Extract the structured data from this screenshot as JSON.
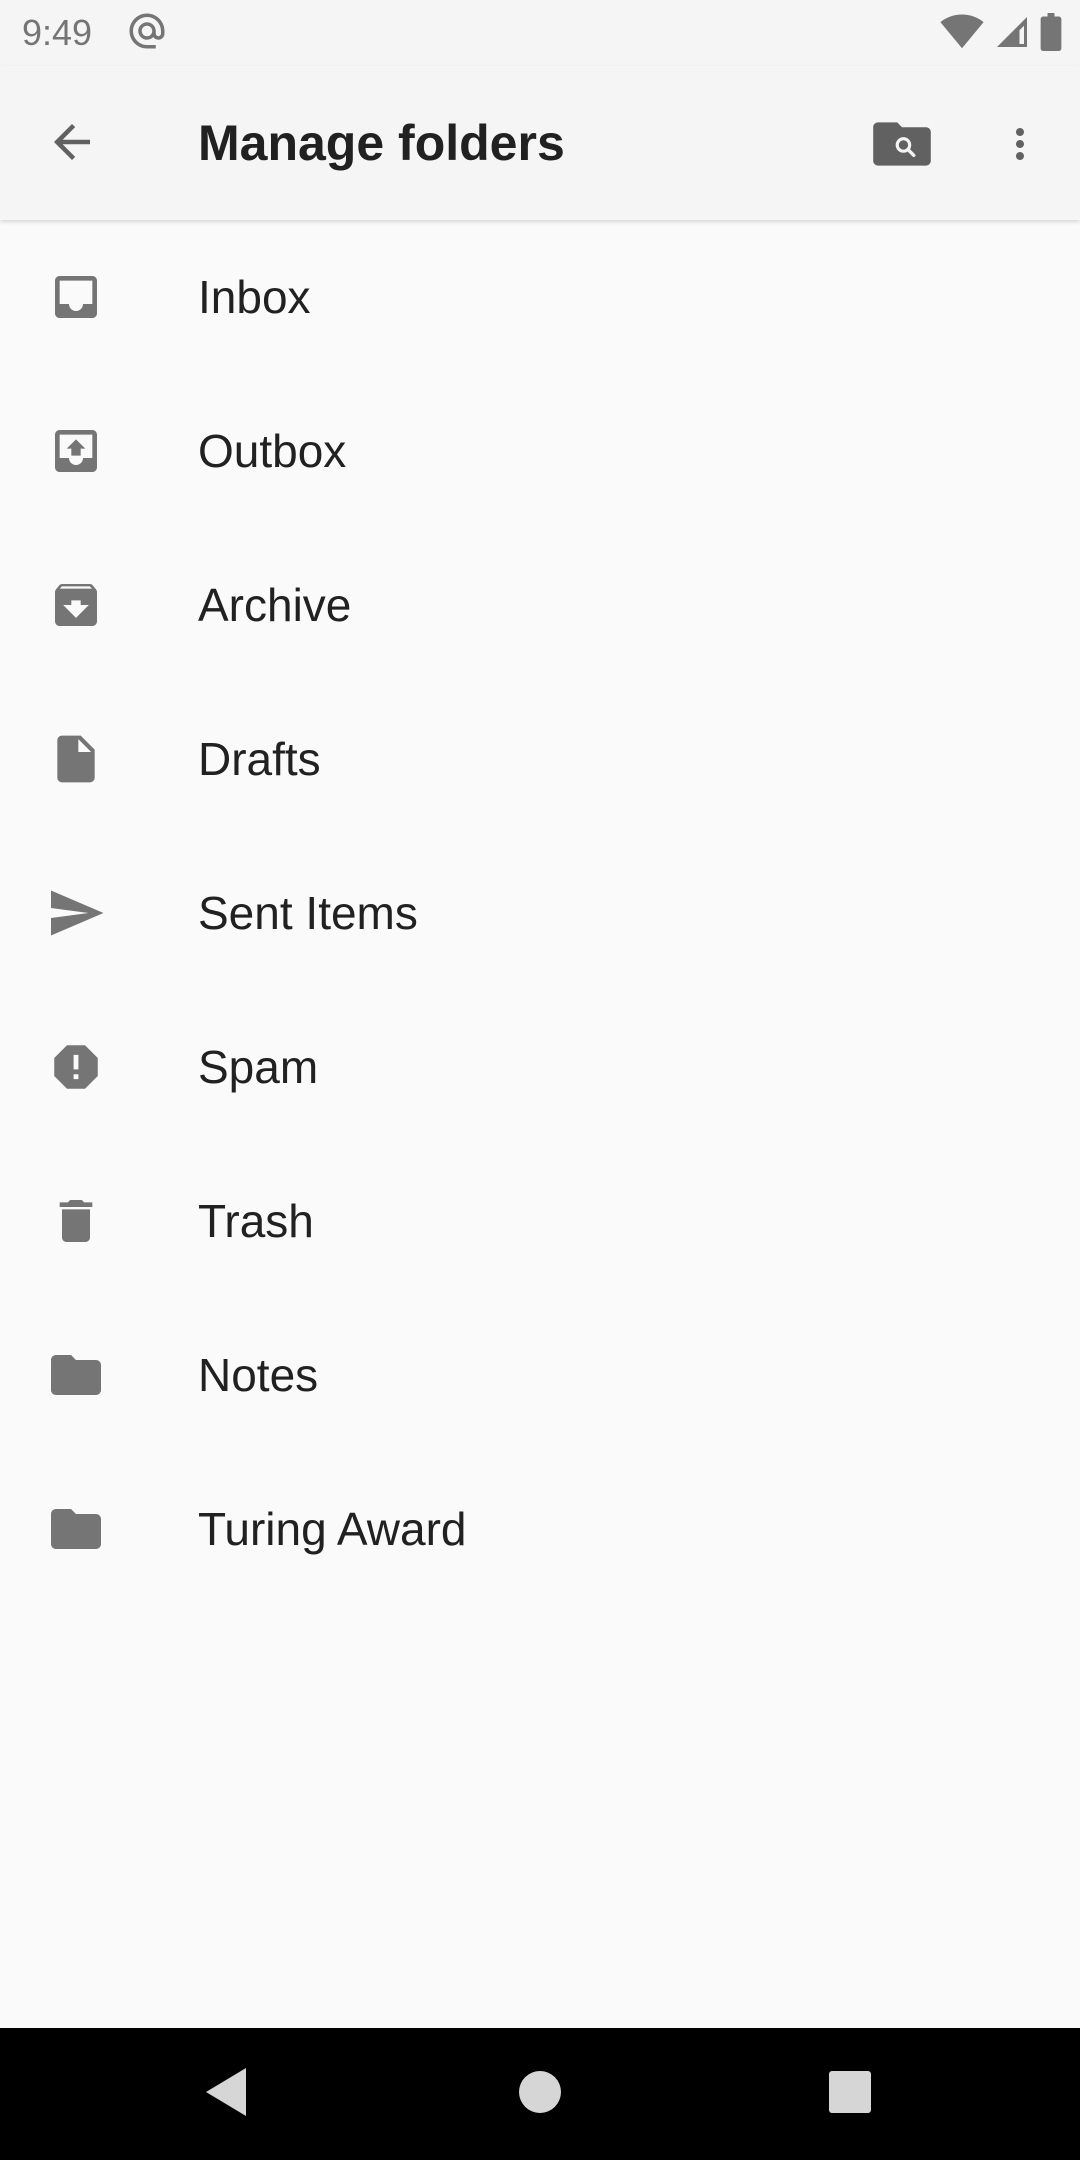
{
  "status_bar": {
    "time": "9:49",
    "notification_icon": "at-sign-icon",
    "icons": [
      "wifi-icon",
      "cell-signal-icon",
      "battery-icon"
    ]
  },
  "app_bar": {
    "title": "Manage folders",
    "back_icon": "arrow-back-icon",
    "actions": [
      "folder-search-icon",
      "more-vert-icon"
    ]
  },
  "folders": [
    {
      "label": "Inbox",
      "icon": "inbox-icon"
    },
    {
      "label": "Outbox",
      "icon": "outbox-icon"
    },
    {
      "label": "Archive",
      "icon": "archive-icon"
    },
    {
      "label": "Drafts",
      "icon": "drafts-icon"
    },
    {
      "label": "Sent Items",
      "icon": "send-icon"
    },
    {
      "label": "Spam",
      "icon": "spam-icon"
    },
    {
      "label": "Trash",
      "icon": "trash-icon"
    },
    {
      "label": "Notes",
      "icon": "folder-icon"
    },
    {
      "label": "Turing Award",
      "icon": "folder-icon"
    }
  ],
  "nav_bar": {
    "buttons": [
      "back-triangle-icon",
      "home-circle-icon",
      "recents-square-icon"
    ]
  },
  "colors": {
    "icon": "#757575",
    "text": "#212121",
    "background": "#fafafa",
    "app_bar": "#f5f5f5",
    "nav_bar": "#000000"
  }
}
